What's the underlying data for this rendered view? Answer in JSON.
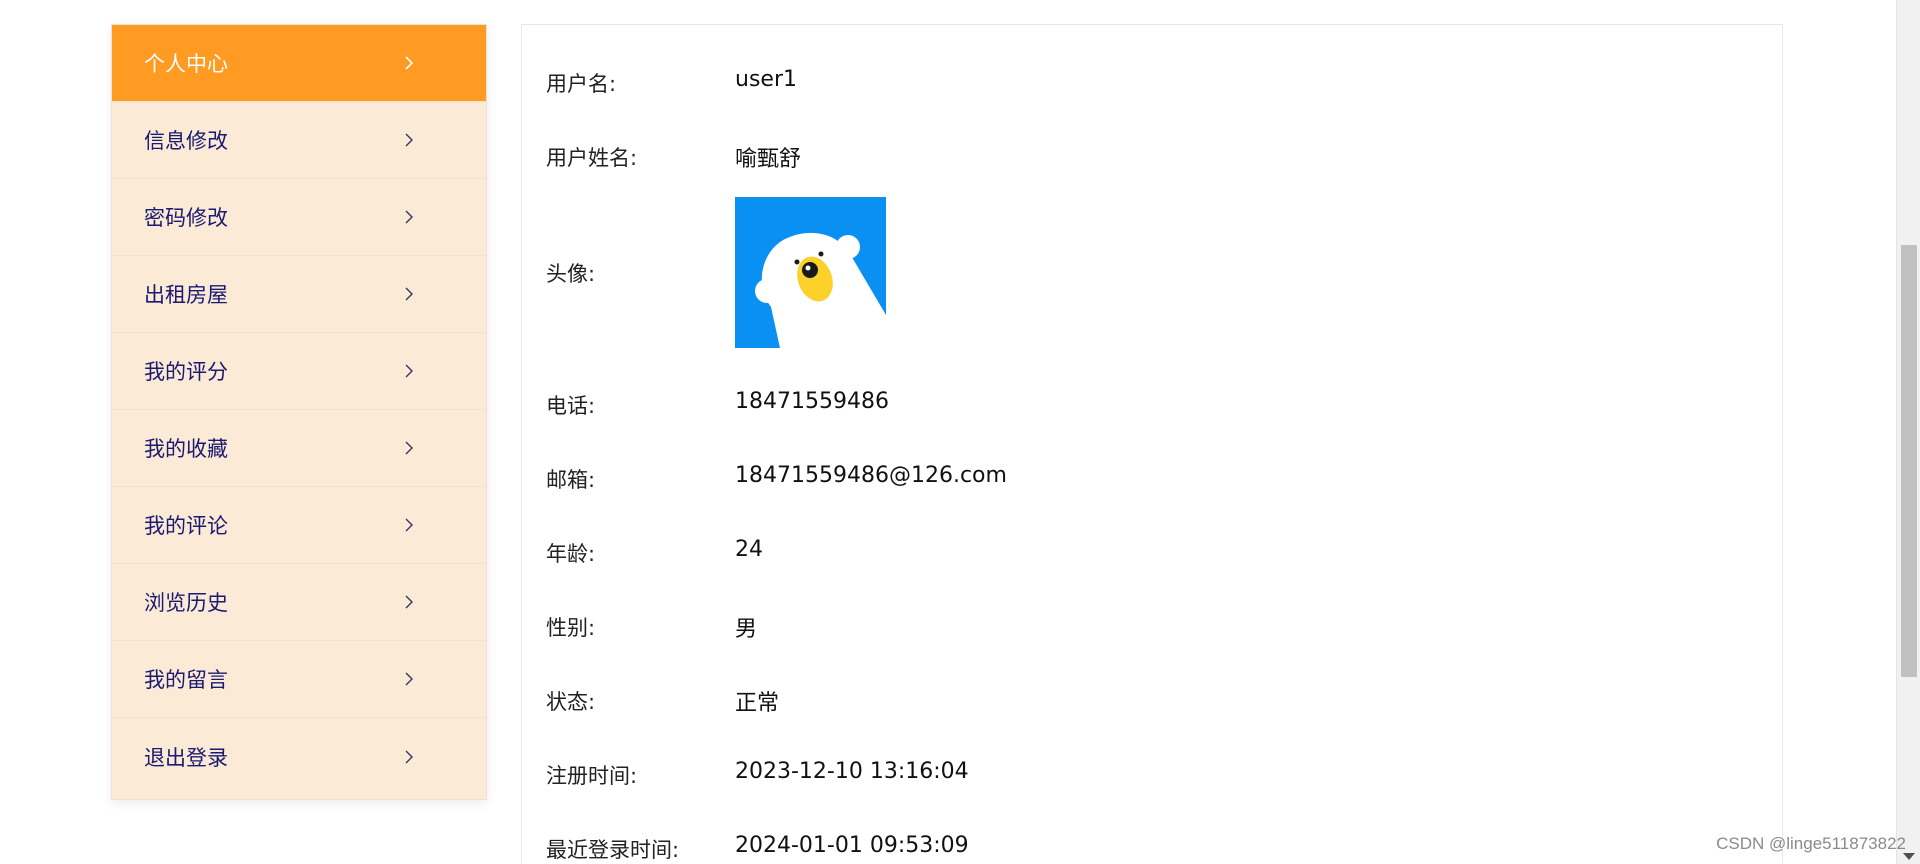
{
  "sidebar": {
    "items": [
      {
        "label": "个人中心",
        "active": true
      },
      {
        "label": "信息修改"
      },
      {
        "label": "密码修改"
      },
      {
        "label": "出租房屋"
      },
      {
        "label": "我的评分"
      },
      {
        "label": "我的收藏"
      },
      {
        "label": "我的评论"
      },
      {
        "label": "浏览历史"
      },
      {
        "label": "我的留言"
      },
      {
        "label": "退出登录"
      }
    ],
    "icon": "chevron-right-icon"
  },
  "profile": {
    "username_label": "用户名:",
    "username": "user1",
    "realname_label": "用户姓名:",
    "realname": "喻甄舒",
    "avatar_label": "头像:",
    "phone_label": "电话:",
    "phone": "18471559486",
    "email_label": "邮箱:",
    "email": "18471559486@126.com",
    "age_label": "年龄:",
    "age": "24",
    "gender_label": "性别:",
    "gender": "男",
    "status_label": "状态:",
    "status": "正常",
    "register_label": "注册时间:",
    "register_time": "2023-12-10 13:16:04",
    "lastlogin_label": "最近登录时间:",
    "last_login_time": "2024-01-01 09:53:09"
  },
  "watermark": "CSDN @linge511873822",
  "colors": {
    "active_bg": "#ff9a22",
    "sidebar_bg": "#fbead5",
    "sidebar_text": "#1a1a73",
    "avatar_bg": "#0a8ff2"
  }
}
